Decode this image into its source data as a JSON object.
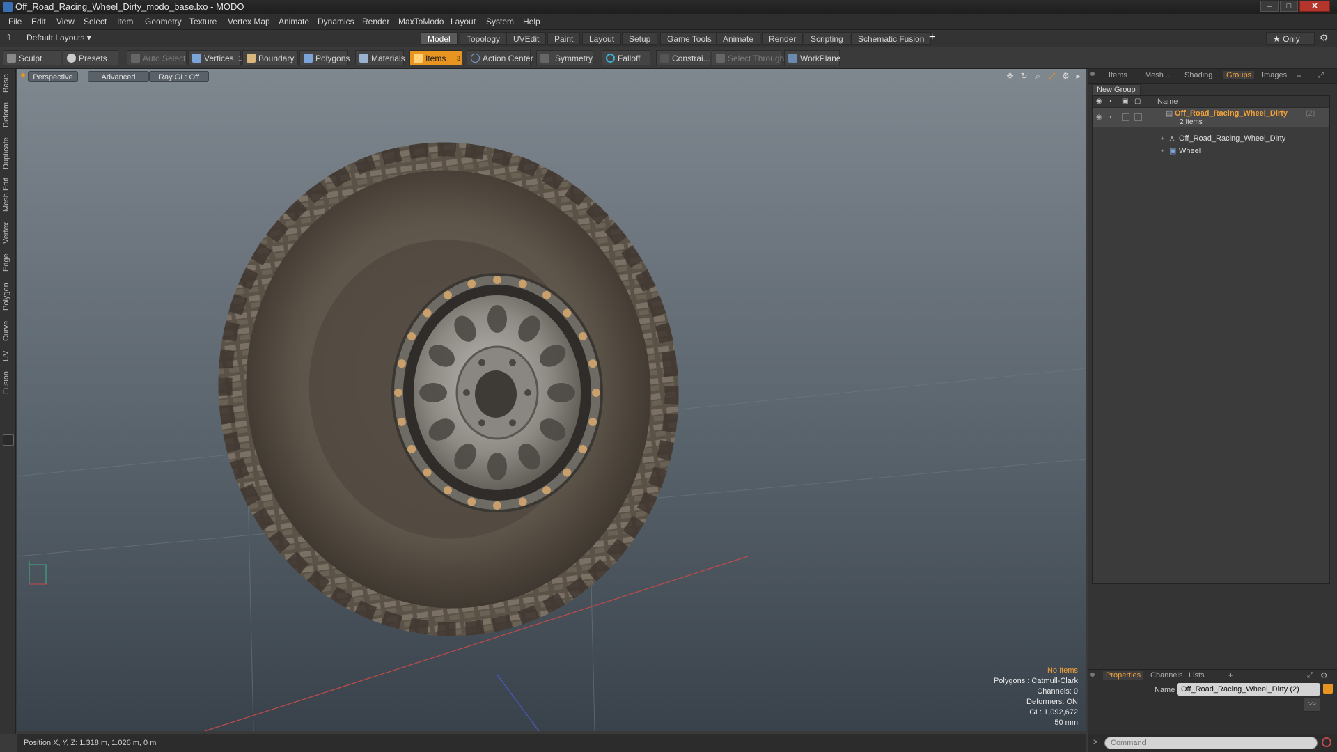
{
  "window": {
    "title": "Off_Road_Racing_Wheel_Dirty_modo_base.lxo - MODO",
    "controls": [
      "–",
      "□",
      "✕"
    ]
  },
  "menu": [
    "File",
    "Edit",
    "View",
    "Select",
    "Item",
    "Geometry",
    "Texture",
    "Vertex Map",
    "Animate",
    "Dynamics",
    "Render",
    "MaxToModo",
    "Layout",
    "System",
    "Help"
  ],
  "layout_bar": {
    "layouts_dropdown": "Default Layouts ▾",
    "tabs": [
      "Model",
      "Topology",
      "UVEdit",
      "Paint",
      "Layout",
      "Setup",
      "Game Tools",
      "Animate",
      "Render",
      "Scripting",
      "Schematic Fusion"
    ],
    "active_tab": "Model",
    "add": "+",
    "only": "★  Only",
    "gear": "⚙"
  },
  "toolbar": {
    "sculpt": "Sculpt",
    "presets": "Presets",
    "auto_select": "Auto Select",
    "vertices": "Vertices",
    "vertices_count": "1",
    "boundary": "Boundary",
    "polygons": "Polygons",
    "materials": "Materials",
    "items": "Items",
    "items_count": "3",
    "action_center": "Action Center",
    "symmetry": "Symmetry",
    "falloff": "Falloff",
    "constraints": "Constrai...",
    "select_through": "Select Through",
    "workplane": "WorkPlane"
  },
  "left_tabs": [
    "Basic",
    "Deform",
    "Duplicate",
    "Mesh Edit",
    "Vertex",
    "Edge",
    "Polygon",
    "Curve",
    "UV",
    "Fusion"
  ],
  "viewport": {
    "view": "Perspective",
    "shading": "Advanced",
    "raygl": "Ray GL: Off",
    "hud": {
      "selection": "No Items",
      "polygons": "Polygons : Catmull-Clark",
      "channels": "Channels: 0",
      "deformers": "Deformers: ON",
      "gl": "GL: 1,092,672",
      "focal": "50 mm"
    }
  },
  "right_panel": {
    "tabs": [
      "Items",
      "Mesh ...",
      "Shading",
      "Groups",
      "Images"
    ],
    "active_tab": "Groups",
    "new_group": "New Group",
    "column_name": "Name",
    "group": {
      "name": "Off_Road_Racing_Wheel_Dirty",
      "count": "(2)",
      "sub": "2 Items",
      "children": [
        "Off_Road_Racing_Wheel_Dirty",
        "Wheel"
      ]
    },
    "bottom_tabs": [
      "Properties",
      "Channels",
      "Lists"
    ],
    "name_label": "Name",
    "name_value": "Off_Road_Racing_Wheel_Dirty (2)",
    "expand": ">>"
  },
  "status": {
    "position": "Position X, Y, Z:   1.318 m, 1.026 m, 0 m",
    "command_placeholder": "Command"
  },
  "colors": {
    "accent": "#e89420",
    "highlight_text": "#f3a23a"
  }
}
